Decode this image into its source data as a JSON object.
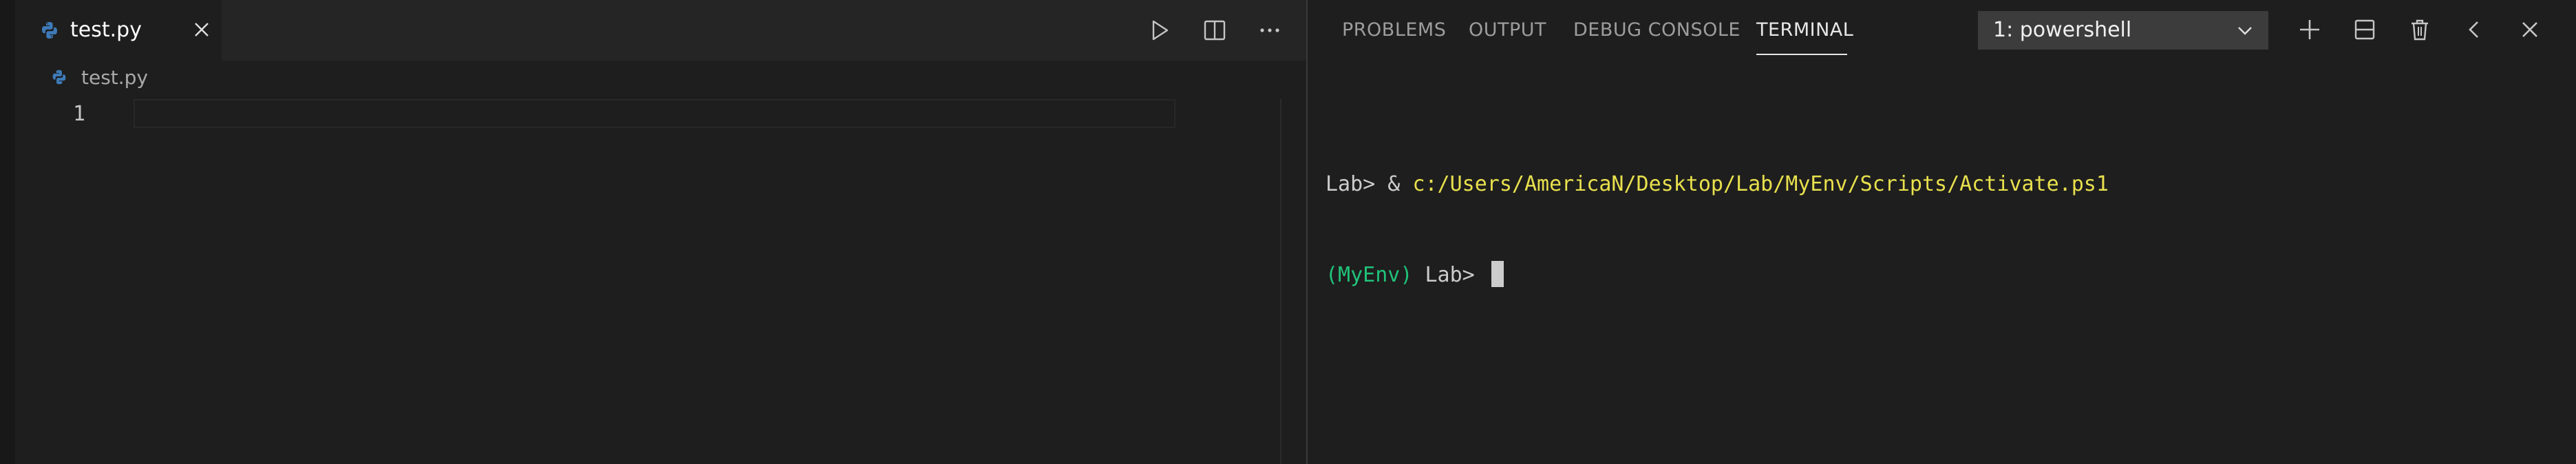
{
  "editor": {
    "tab": {
      "label": "test.py",
      "icon": "python-icon",
      "close_icon": "close-icon"
    },
    "actions": [
      {
        "name": "run-icon"
      },
      {
        "name": "split-editor-icon"
      },
      {
        "name": "more-actions-icon"
      }
    ],
    "breadcrumb": {
      "label": "test.py",
      "icon": "python-icon"
    },
    "line_numbers": [
      "1"
    ]
  },
  "panel": {
    "tabs": [
      {
        "label": "PROBLEMS",
        "active": false
      },
      {
        "label": "OUTPUT",
        "active": false
      },
      {
        "label": "DEBUG CONSOLE",
        "active": false
      },
      {
        "label": "TERMINAL",
        "active": true
      }
    ],
    "terminal_select": {
      "value": "1: powershell"
    },
    "actions": [
      {
        "name": "new-terminal-icon"
      },
      {
        "name": "split-terminal-icon"
      },
      {
        "name": "kill-terminal-icon"
      },
      {
        "name": "maximize-panel-icon"
      },
      {
        "name": "close-panel-icon"
      }
    ],
    "terminal": {
      "line1_prompt": "Lab> & ",
      "line1_path": "c:/Users/AmericaN/Desktop/Lab/MyEnv/Scripts/Activate.ps1",
      "line2_env": "(MyEnv)",
      "line2_prompt": " Lab> "
    }
  },
  "colors": {
    "background": "#1e1e1e",
    "tabbar": "#252526",
    "path_yellow": "#e8e04d",
    "env_green": "#20c37a",
    "python_blue": "#3e7ab8"
  }
}
